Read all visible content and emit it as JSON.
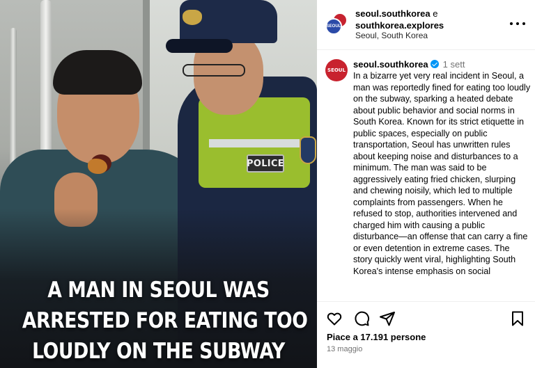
{
  "media": {
    "headline_lines": [
      "A MAN IN SEOUL WAS",
      "ARRESTED FOR EATING TOO",
      "LOUDLY ON THE SUBWAY"
    ],
    "police_patch": "POLICE"
  },
  "header": {
    "user1": "seoul.southkorea",
    "conjunction": "e",
    "user2": "southkorea.explores",
    "location": "Seoul, South Korea",
    "avatar_text": "SEOUL",
    "more_icon": "more-horizontal-icon"
  },
  "caption": {
    "avatar_text": "SEOUL",
    "username": "seoul.southkorea",
    "time": "1 sett",
    "text": "In a bizarre yet very real incident in Seoul, a man was reportedly fined for eating too loudly on the subway, sparking a heated debate about public behavior and social norms in South Korea. Known for its strict etiquette in public spaces, especially on public transportation, Seoul has unwritten rules about keeping noise and disturbances to a minimum. The man was said to be aggressively eating fried chicken, slurping and chewing noisily, which led to multiple complaints from passengers. When he refused to stop, authorities intervened and charged him with causing a public disturbance—an offense that can carry a fine or even detention in extreme cases. The story quickly went viral, highlighting South Korea's intense emphasis on social"
  },
  "actions": {
    "likes": "Piace a 17.191 persone",
    "date": "13 maggio"
  },
  "colors": {
    "verified": "#0095f6",
    "avatar_red": "#c8222e",
    "avatar_blue": "#2b4aa8",
    "vest": "#a9cf2c",
    "uniform": "#1b2742"
  }
}
